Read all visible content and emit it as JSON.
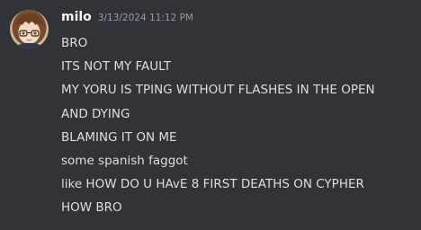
{
  "message": {
    "author": "milo",
    "timestamp": "3/13/2024 11:12 PM",
    "avatar_icon": "anime-avatar-brown-hair-glasses",
    "lines": [
      "BRO",
      "ITS NOT MY FAULT",
      "MY YORU IS TPING WITHOUT FLASHES IN THE OPEN",
      "AND DYING",
      "BLAMING IT ON ME",
      "some spanish faggot",
      "like HOW DO U HAvE 8 FIRST DEATHS ON CYPHER",
      "HOW BRO"
    ]
  },
  "colors": {
    "background": "#313338",
    "username": "#f2f3f5",
    "text": "#dbdee1",
    "timestamp": "#949ba4"
  }
}
